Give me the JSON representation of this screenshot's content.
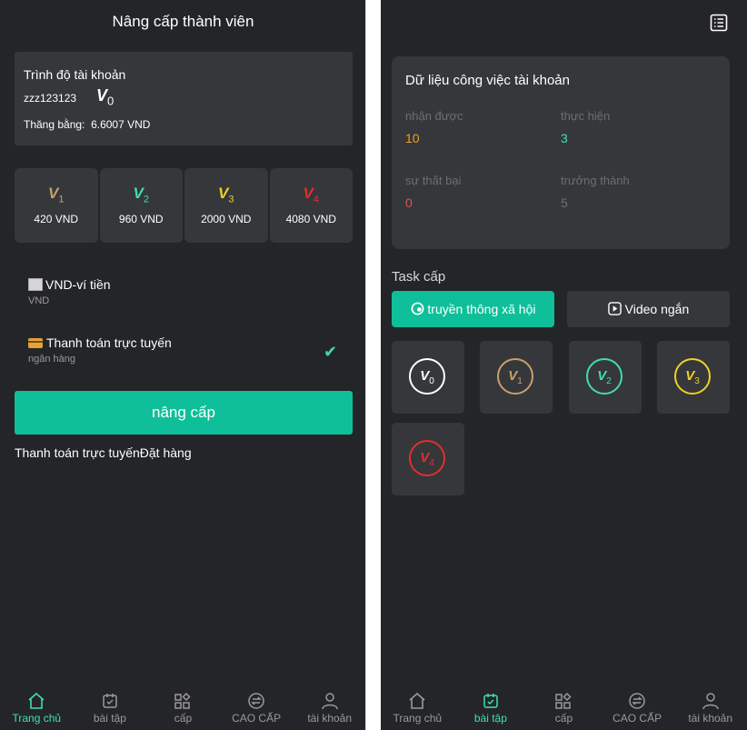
{
  "colors": {
    "bg": "#242528",
    "card": "#35373b",
    "accent": "#0fbf9a",
    "gold": "#c8a06a",
    "green": "#3fe0a0",
    "yellow": "#f0d020",
    "red": "#e0302a",
    "orange": "#f0a020",
    "teal": "#3fe0c0",
    "muted_red": "#e05050"
  },
  "left": {
    "title": "Nâng cấp thành viên",
    "account": {
      "title": "Trình độ tài khoản",
      "username": "zzz123123",
      "badge_letter": "V",
      "badge_level": "0",
      "balance_label": "Thăng bằng:",
      "balance_value": "6.6007 VND"
    },
    "levels": [
      {
        "letter": "V",
        "num": "1",
        "price": "420 VND",
        "color": "#c8a06a"
      },
      {
        "letter": "V",
        "num": "2",
        "price": "960 VND",
        "color": "#3fe0a0"
      },
      {
        "letter": "V",
        "num": "3",
        "price": "2000 VND",
        "color": "#f0d020"
      },
      {
        "letter": "V",
        "num": "4",
        "price": "4080 VND",
        "color": "#e0302a"
      }
    ],
    "payments": [
      {
        "name": "VND-ví tiền",
        "sub": "VND",
        "icon": "broken-image-icon"
      },
      {
        "name": "Thanh toán trực tuyến",
        "sub": "ngân hàng",
        "icon": "card-icon",
        "selected": true
      }
    ],
    "upgrade_button": "nâng cấp",
    "order_text": "Thanh toán trực tuyếnĐặt hàng",
    "tabs": [
      {
        "label": "Trang chủ",
        "icon": "home-icon",
        "active": true
      },
      {
        "label": "bài tập",
        "icon": "task-icon",
        "active": false
      },
      {
        "label": "cấp",
        "icon": "grid-icon",
        "active": false
      },
      {
        "label": "CAO CẤP",
        "icon": "exchange-icon",
        "active": false
      },
      {
        "label": "tài khoản",
        "icon": "user-icon",
        "active": false
      }
    ]
  },
  "right": {
    "work": {
      "title": "Dữ liệu công việc tài khoản",
      "stats": [
        {
          "label": "nhận được",
          "value": "10",
          "color": "#f0a020"
        },
        {
          "label": "thực hiện",
          "value": "3",
          "color": "#3fe0c0"
        },
        {
          "label": "sự thất bại",
          "value": "0",
          "color": "#e05050"
        },
        {
          "label": "trưởng thành",
          "value": "5",
          "color": "#6c6e72"
        }
      ]
    },
    "task_title": "Task cấp",
    "task_buttons": [
      {
        "label": "truyền thông xã hội",
        "icon": "share-icon"
      },
      {
        "label": "Video ngắn",
        "icon": "play-icon"
      }
    ],
    "level_grid": [
      {
        "letter": "V",
        "num": "0",
        "color": "#ffffff"
      },
      {
        "letter": "V",
        "num": "1",
        "color": "#c8a06a"
      },
      {
        "letter": "V",
        "num": "2",
        "color": "#3fe0a0"
      },
      {
        "letter": "V",
        "num": "3",
        "color": "#f0d020"
      },
      {
        "letter": "V",
        "num": "4",
        "color": "#e0302a"
      }
    ],
    "tabs": [
      {
        "label": "Trang chủ",
        "icon": "home-icon",
        "active": false
      },
      {
        "label": "bài tập",
        "icon": "task-icon",
        "active": true
      },
      {
        "label": "cấp",
        "icon": "grid-icon",
        "active": false
      },
      {
        "label": "CAO CẤP",
        "icon": "exchange-icon",
        "active": false
      },
      {
        "label": "tài khoản",
        "icon": "user-icon",
        "active": false
      }
    ]
  }
}
